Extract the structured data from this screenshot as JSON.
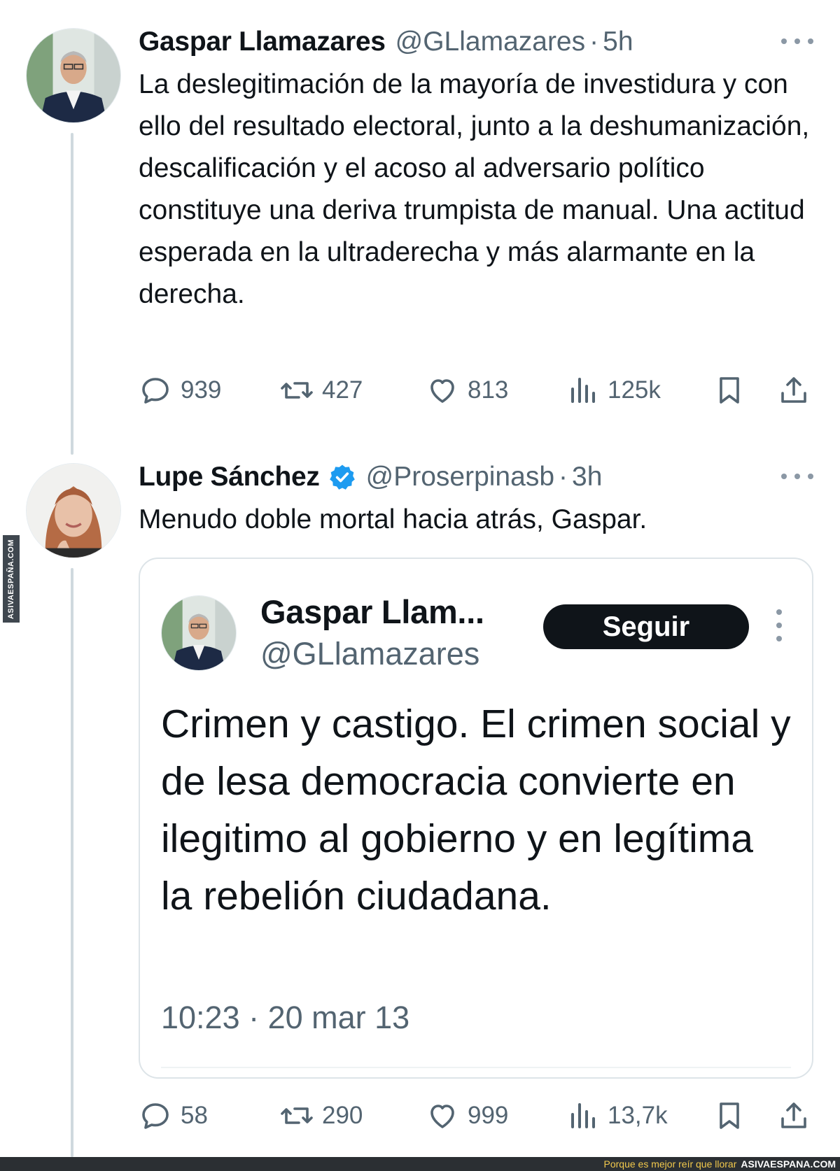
{
  "colors": {
    "text": "#0f1419",
    "secondary": "#536471",
    "verified_badge": "#1d9bf0",
    "thread_line": "#cfd9de",
    "follow_button_bg": "#0f1419",
    "footer_tagline": "#f2c94c"
  },
  "tweet1": {
    "author_name": "Gaspar Llamazares",
    "handle": "@GLlamazares",
    "separator": "·",
    "time": "5h",
    "text": "La deslegitimación de la mayoría de investidura y con ello del resultado electoral, junto a la deshumanización, descalificación y el acoso al adversario político constituye una deriva trumpista de manual. Una actitud esperada en la ultraderecha y más alarmante en la derecha.",
    "stats": {
      "replies": "939",
      "retweets": "427",
      "likes": "813",
      "views": "125k"
    },
    "icons": [
      "reply-icon",
      "retweet-icon",
      "heart-icon",
      "views-icon",
      "bookmark-icon",
      "share-icon",
      "more-icon"
    ]
  },
  "tweet2": {
    "author_name": "Lupe Sánchez",
    "verified": true,
    "handle": "@Proserpinasb",
    "separator": "·",
    "time": "3h",
    "text": "Menudo doble mortal hacia atrás,  Gaspar.",
    "quoted": {
      "author_name": "Gaspar Llam...",
      "handle": "@GLlamazares",
      "follow_label": "Seguir",
      "text": "Crimen y castigo. El crimen social y de lesa democracia convierte en ilegitimo al gobierno y en legítima la rebelión ciudadana.",
      "date": "10:23 · 20 mar 13"
    },
    "stats": {
      "replies": "58",
      "retweets": "290",
      "likes": "999",
      "views": "13,7k"
    }
  },
  "watermark": {
    "side_text": "ASIVAESPAÑA.COM",
    "footer_tagline": "Porque es mejor reír que llorar",
    "footer_site": "ASIVAESPANA.COM"
  }
}
